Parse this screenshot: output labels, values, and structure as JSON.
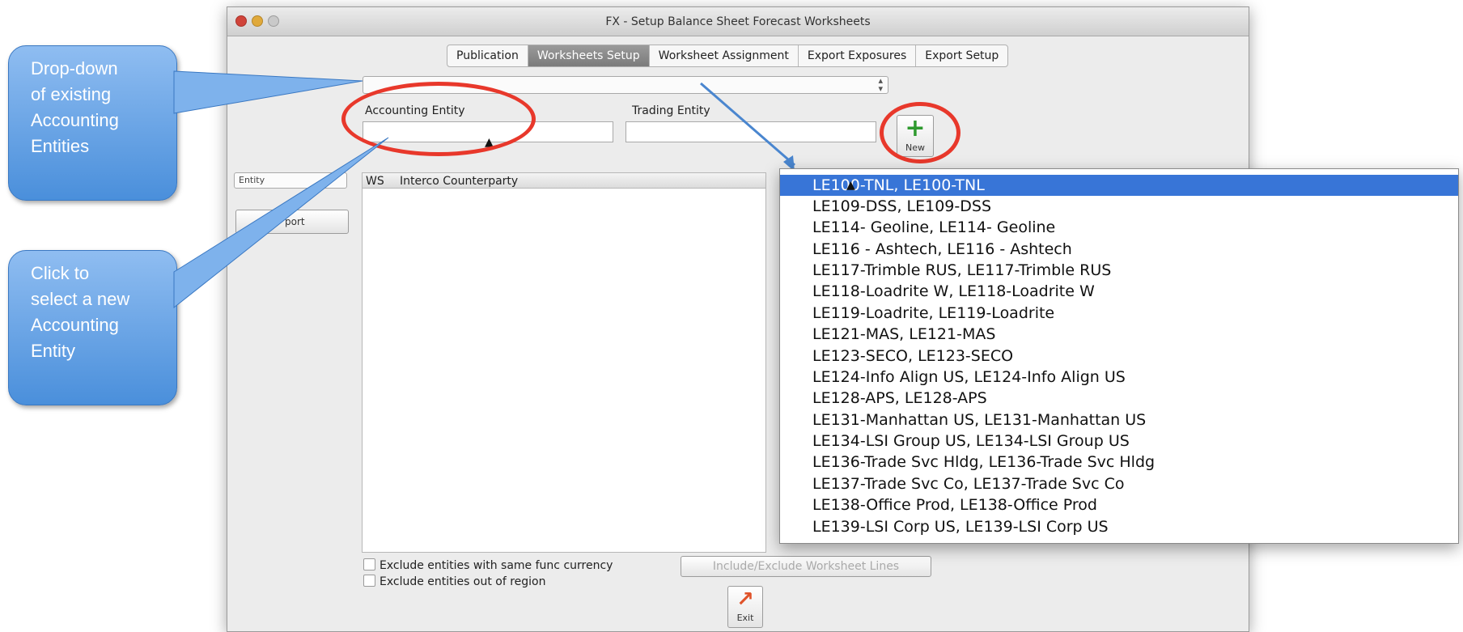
{
  "callouts": {
    "dropdown_note": [
      "Drop-down",
      "of existing",
      "Accounting",
      "Entities"
    ],
    "select_note": [
      "Click to",
      "select a new",
      "Accounting",
      "Entity"
    ]
  },
  "window": {
    "title": "FX - Setup Balance Sheet Forecast Worksheets",
    "tabs": [
      {
        "label": "Publication",
        "active": false
      },
      {
        "label": "Worksheets Setup",
        "active": true
      },
      {
        "label": "Worksheet Assignment",
        "active": false
      },
      {
        "label": "Export Exposures",
        "active": false
      },
      {
        "label": "Export Setup",
        "active": false
      }
    ]
  },
  "form": {
    "entity_dropdown_value": "",
    "accounting_entity_label": "Accounting Entity",
    "accounting_entity_value": "",
    "trading_entity_label": "Trading Entity",
    "trading_entity_value": "",
    "new_button_label": "New",
    "sidebar_popup_value": "Entity",
    "sidebar_button_label": "port",
    "list_col_ws": "WS",
    "list_col_counterparty": "Interco Counterparty",
    "exclude_same_currency": "Exclude entities with same func currency",
    "exclude_out_of_region": "Exclude entities out of region",
    "include_exclude_button": "Include/Exclude Worksheet Lines",
    "exit_button_label": "Exit"
  },
  "dropdown_items": [
    "LE100-TNL,  LE100-TNL",
    "LE109-DSS,  LE109-DSS",
    "LE114- Geoline,  LE114- Geoline",
    "LE116 - Ashtech,  LE116 - Ashtech",
    "LE117-Trimble RUS,  LE117-Trimble RUS",
    "LE118-Loadrite W,  LE118-Loadrite W",
    "LE119-Loadrite,  LE119-Loadrite",
    "LE121-MAS,  LE121-MAS",
    "LE123-SECO,  LE123-SECO",
    "LE124-Info Align US,  LE124-Info Align US",
    "LE128-APS,  LE128-APS",
    "LE131-Manhattan US,  LE131-Manhattan US",
    "LE134-LSI Group US,  LE134-LSI Group US",
    "LE136-Trade Svc Hldg,  LE136-Trade Svc Hldg",
    "LE137-Trade Svc Co,  LE137-Trade Svc Co",
    "LE138-Office Prod,  LE138-Office Prod",
    "LE139-LSI Corp US,  LE139-LSI Corp US"
  ],
  "dropdown_selected_index": 0,
  "colors": {
    "callout": "#4a8fdb",
    "highlight_ring": "#e8382b",
    "selection": "#3875d7",
    "new_icon": "#2e9a2e",
    "exit_icon": "#e0532a"
  }
}
